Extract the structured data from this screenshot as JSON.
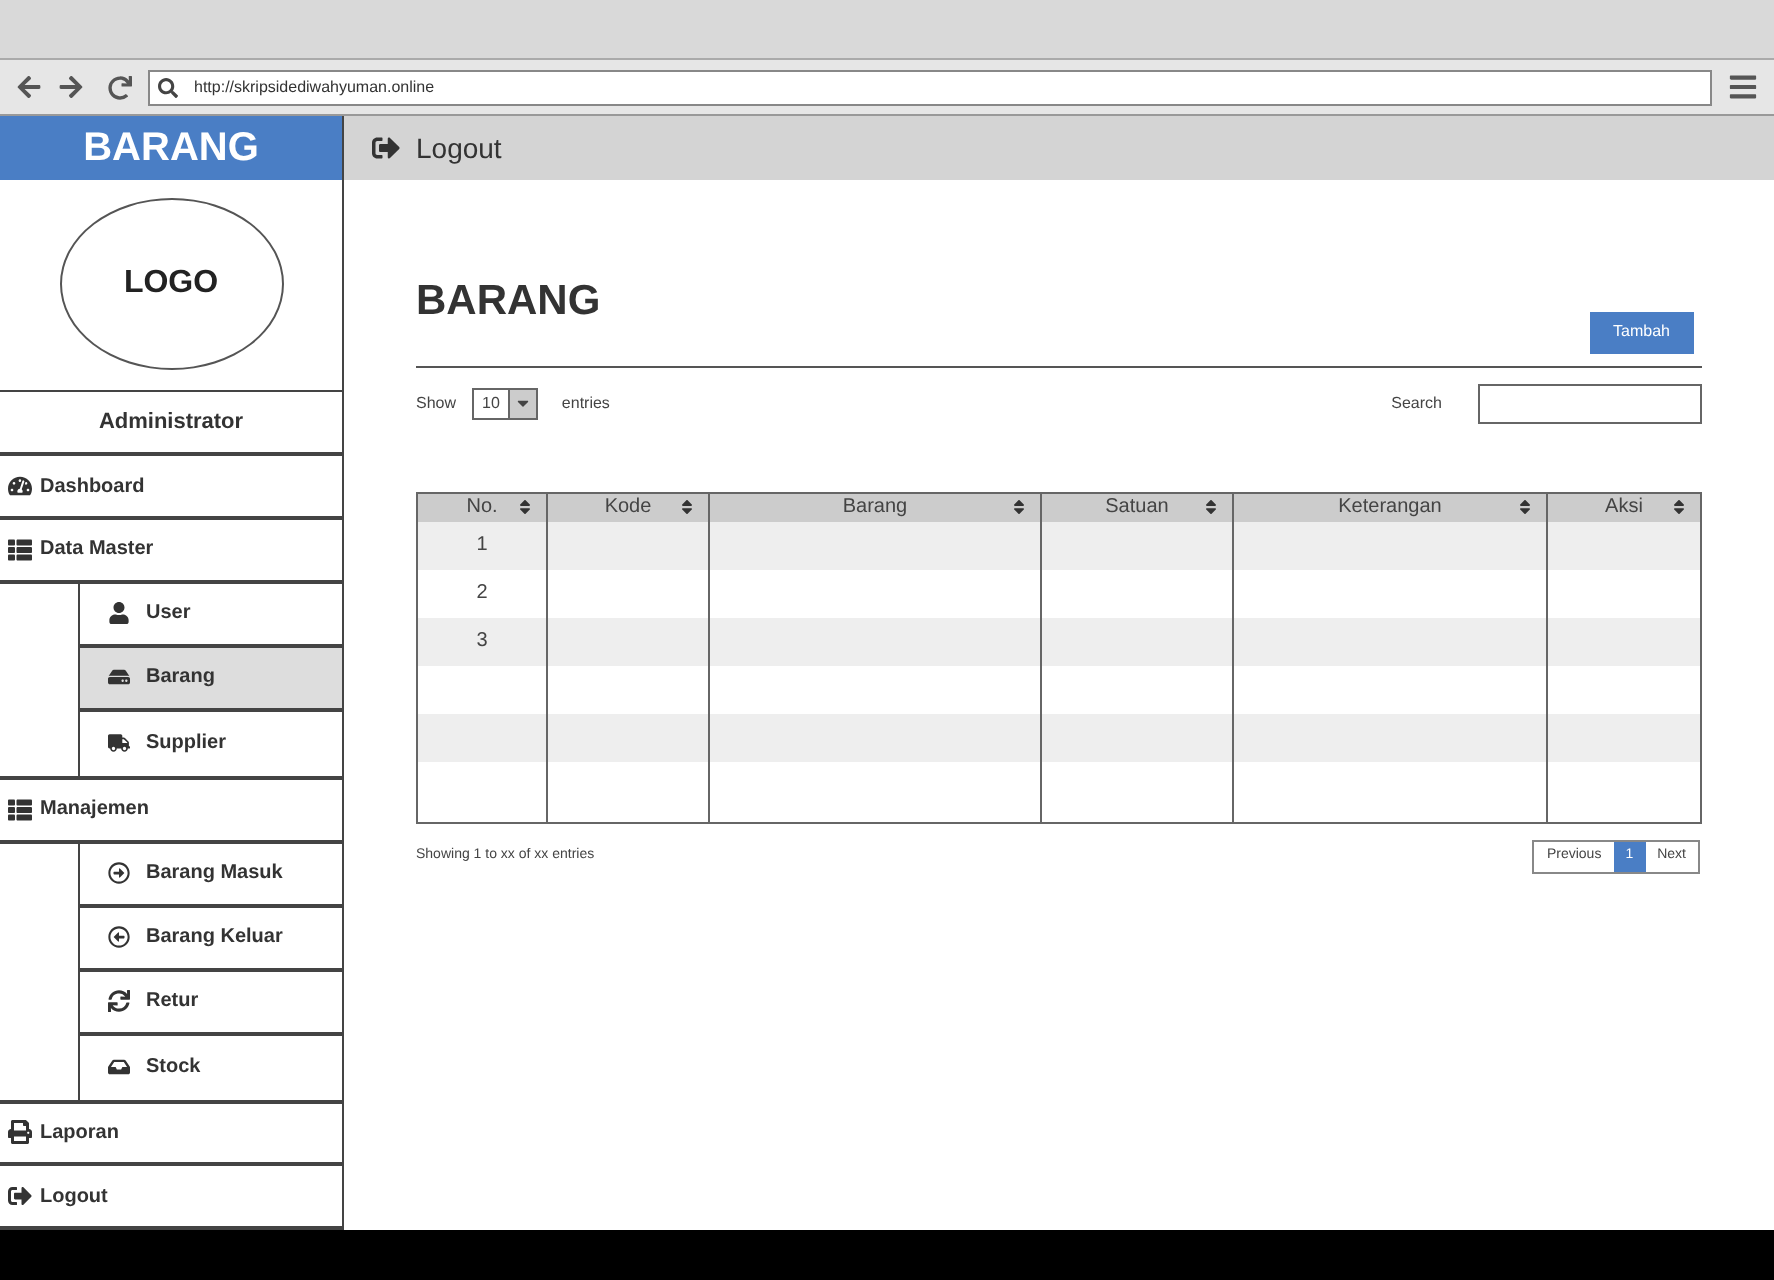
{
  "browser": {
    "url": "http://skripsidediwahyuman.online"
  },
  "sidebar": {
    "brand": "BARANG",
    "logo": "LOGO",
    "role": "Administrator",
    "menu": [
      {
        "label": "Dashboard",
        "selected": false
      },
      {
        "label": "Data Master",
        "selected": false,
        "children": [
          {
            "label": "User",
            "selected": false
          },
          {
            "label": "Barang",
            "selected": true
          },
          {
            "label": "Supplier",
            "selected": false
          }
        ]
      },
      {
        "label": "Manajemen",
        "selected": false,
        "children": [
          {
            "label": "Barang Masuk",
            "selected": false
          },
          {
            "label": "Barang Keluar",
            "selected": false
          },
          {
            "label": "Retur",
            "selected": false
          },
          {
            "label": "Stock",
            "selected": false
          }
        ]
      },
      {
        "label": "Laporan",
        "selected": false
      },
      {
        "label": "Logout",
        "selected": false
      }
    ]
  },
  "topbar": {
    "logout": "Logout"
  },
  "content": {
    "title": "BARANG",
    "add_button": "Tambah",
    "show_label": "Show",
    "page_length": "10",
    "entries_label": "entries",
    "search_label": "Search",
    "table": {
      "columns": [
        "No.",
        "Kode",
        "Barang",
        "Satuan",
        "Keterangan",
        "Aksi"
      ],
      "rows": [
        [
          "1"
        ],
        [
          "2"
        ],
        [
          "3"
        ]
      ]
    },
    "info": "Showing 1 to xx of xx entries",
    "pagination": [
      {
        "label": "Previous",
        "selected": false
      },
      {
        "label": "1",
        "selected": true
      },
      {
        "label": "Next",
        "selected": false
      }
    ]
  }
}
